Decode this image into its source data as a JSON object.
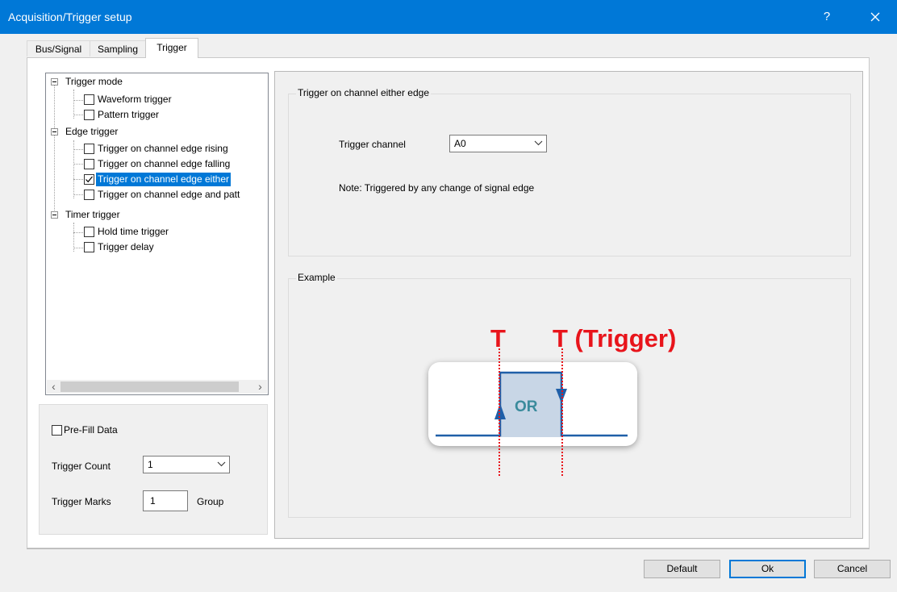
{
  "window": {
    "title": "Acquisition/Trigger setup",
    "help_label": "?",
    "close_label": "✕"
  },
  "tabs": [
    {
      "label": "Bus/Signal",
      "active": false
    },
    {
      "label": "Sampling",
      "active": false
    },
    {
      "label": "Trigger",
      "active": true
    }
  ],
  "tree": {
    "groups": [
      {
        "label": "Trigger mode",
        "items": [
          {
            "label": "Waveform trigger",
            "checked": false
          },
          {
            "label": "Pattern trigger",
            "checked": false
          }
        ]
      },
      {
        "label": "Edge trigger",
        "items": [
          {
            "label": "Trigger on channel edge rising",
            "checked": false
          },
          {
            "label": "Trigger on channel edge falling",
            "checked": false
          },
          {
            "label": "Trigger on channel edge either",
            "checked": true,
            "selected": true
          },
          {
            "label": "Trigger on channel edge and patt",
            "checked": false
          }
        ]
      },
      {
        "label": "Timer trigger",
        "items": [
          {
            "label": "Hold time trigger",
            "checked": false
          },
          {
            "label": "Trigger delay",
            "checked": false
          }
        ]
      }
    ],
    "scroll_left": "‹",
    "scroll_right": "›"
  },
  "options": {
    "prefill_label": "Pre-Fill Data",
    "prefill_checked": false,
    "trigger_count_label": "Trigger Count",
    "trigger_count_value": "1",
    "trigger_marks_label": "Trigger Marks",
    "trigger_marks_value": "1",
    "group_label": "Group"
  },
  "settings": {
    "legend": "Trigger on channel either edge",
    "channel_label": "Trigger channel",
    "channel_value": "A0",
    "note": "Note: Triggered by any change of signal edge"
  },
  "example": {
    "legend": "Example",
    "t1_label": "T",
    "t2_label": "T (Trigger)",
    "or_label": "OR",
    "colors": {
      "red": "#e8141b",
      "blue": "#1f5fa8",
      "fill": "#c8d6e6",
      "teal": "#3a8b9c"
    }
  },
  "buttons": {
    "default_label": "Default",
    "ok_label": "Ok",
    "cancel_label": "Cancel"
  }
}
